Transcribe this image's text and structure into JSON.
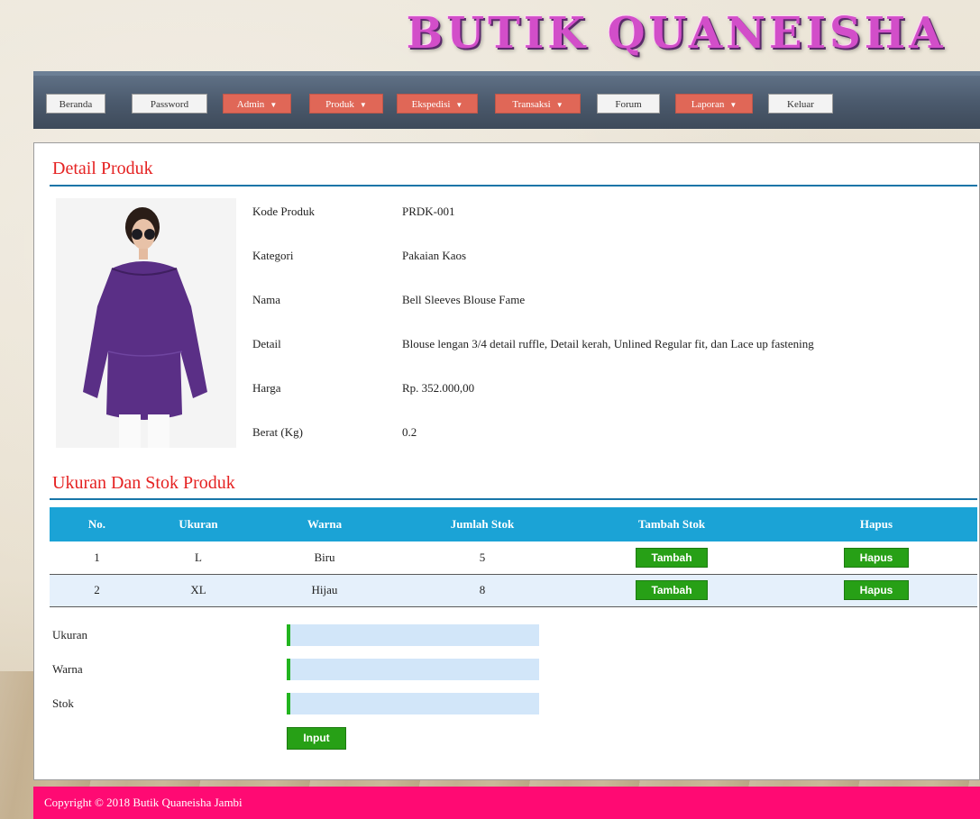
{
  "site": {
    "banner_title": "BUTIK QUANEISHA JAMBI"
  },
  "nav": {
    "items": [
      {
        "label": "Beranda",
        "dropdown": false
      },
      {
        "label": "Password",
        "dropdown": false
      },
      {
        "label": "Admin",
        "dropdown": true
      },
      {
        "label": "Produk",
        "dropdown": true
      },
      {
        "label": "Ekspedisi",
        "dropdown": true
      },
      {
        "label": "Transaksi",
        "dropdown": true
      },
      {
        "label": "Forum",
        "dropdown": false
      },
      {
        "label": "Laporan",
        "dropdown": true
      },
      {
        "label": "Keluar",
        "dropdown": false
      }
    ],
    "caret": "▼"
  },
  "detail": {
    "title": "Detail Produk",
    "fields": [
      {
        "label": "Kode Produk",
        "value": "PRDK-001"
      },
      {
        "label": "Kategori",
        "value": "Pakaian Kaos"
      },
      {
        "label": "Nama",
        "value": "Bell Sleeves Blouse Fame"
      },
      {
        "label": "Detail",
        "value": "Blouse lengan 3/4 detail ruffle, Detail kerah, Unlined Regular fit, dan Lace up fastening"
      },
      {
        "label": "Harga",
        "value": "Rp. 352.000,00"
      },
      {
        "label": "Berat (Kg)",
        "value": "0.2"
      }
    ]
  },
  "stock": {
    "title": "Ukuran Dan Stok Produk",
    "columns": [
      "No.",
      "Ukuran",
      "Warna",
      "Jumlah Stok",
      "Tambah Stok",
      "Hapus"
    ],
    "rows": [
      {
        "no": "1",
        "ukuran": "L",
        "warna": "Biru",
        "jumlah": "5",
        "tambah_label": "Tambah",
        "hapus_label": "Hapus"
      },
      {
        "no": "2",
        "ukuran": "XL",
        "warna": "Hijau",
        "jumlah": "8",
        "tambah_label": "Tambah",
        "hapus_label": "Hapus"
      }
    ]
  },
  "form": {
    "ukuran_label": "Ukuran",
    "ukuran_value": "",
    "warna_label": "Warna",
    "warna_value": "",
    "stok_label": "Stok",
    "stok_value": "",
    "submit_label": "Input"
  },
  "footer": {
    "text": "Copyright © 2018 Butik Quaneisha Jambi"
  },
  "colors": {
    "accent_red": "#e52222",
    "table_header": "#1ba3d6",
    "button_green": "#27a016",
    "footer_pink": "#ff0a73",
    "nav_dropdown": "#e06757"
  }
}
